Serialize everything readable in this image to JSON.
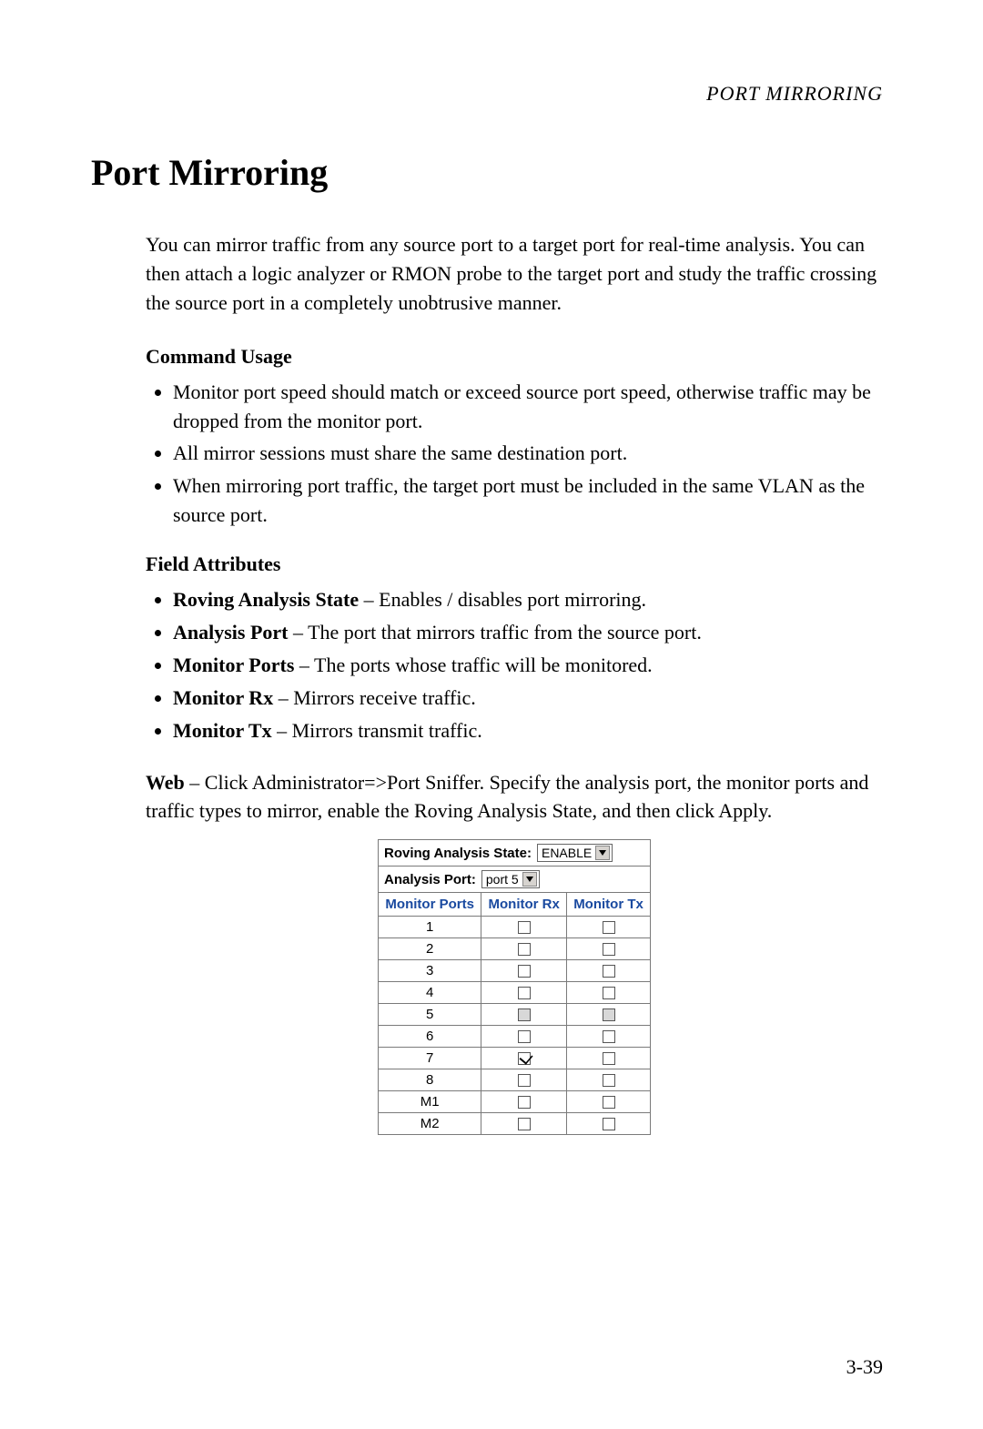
{
  "running_head": "PORT MIRRORING",
  "title": "Port Mirroring",
  "intro": "You can mirror traffic from any source port to a target port for real-time analysis. You can then attach a logic analyzer or RMON probe to the target port and study the traffic crossing the source port in a completely unobtrusive manner.",
  "command_usage": {
    "heading": "Command Usage",
    "items": [
      "Monitor port speed should match or exceed source port speed, otherwise traffic may be dropped from the monitor port.",
      "All mirror sessions must share the same destination port.",
      "When mirroring port traffic, the target port must be included in the same VLAN as the source port."
    ]
  },
  "field_attributes": {
    "heading": "Field Attributes",
    "items": [
      {
        "term": "Roving Analysis State",
        "desc": " – Enables / disables port mirroring."
      },
      {
        "term": "Analysis Port",
        "desc": " – The port that mirrors traffic from the source port."
      },
      {
        "term": "Monitor Ports",
        "desc": " – The ports whose traffic will be monitored."
      },
      {
        "term": "Monitor Rx",
        "desc": " – Mirrors receive traffic."
      },
      {
        "term": "Monitor Tx",
        "desc": " – Mirrors transmit traffic."
      }
    ]
  },
  "web_para": {
    "label": "Web",
    "text": " – Click Administrator=>Port Sniffer. Specify the analysis port, the monitor ports and traffic types to mirror, enable the Roving Analysis State, and then click Apply."
  },
  "sniffer": {
    "state_label": "Roving Analysis State:",
    "state_value": "ENABLE",
    "analysis_label": "Analysis Port:",
    "analysis_value": "port 5",
    "columns": {
      "ports": "Monitor Ports",
      "rx": "Monitor Rx",
      "tx": "Monitor Tx"
    },
    "rows": [
      {
        "port": "1",
        "rx": "off",
        "tx": "off"
      },
      {
        "port": "2",
        "rx": "off",
        "tx": "off"
      },
      {
        "port": "3",
        "rx": "off",
        "tx": "off"
      },
      {
        "port": "4",
        "rx": "off",
        "tx": "off"
      },
      {
        "port": "5",
        "rx": "disabled",
        "tx": "disabled"
      },
      {
        "port": "6",
        "rx": "off",
        "tx": "off"
      },
      {
        "port": "7",
        "rx": "on",
        "tx": "off"
      },
      {
        "port": "8",
        "rx": "off",
        "tx": "off"
      },
      {
        "port": "M1",
        "rx": "off",
        "tx": "off"
      },
      {
        "port": "M2",
        "rx": "off",
        "tx": "off"
      }
    ]
  },
  "page_number": "3-39"
}
